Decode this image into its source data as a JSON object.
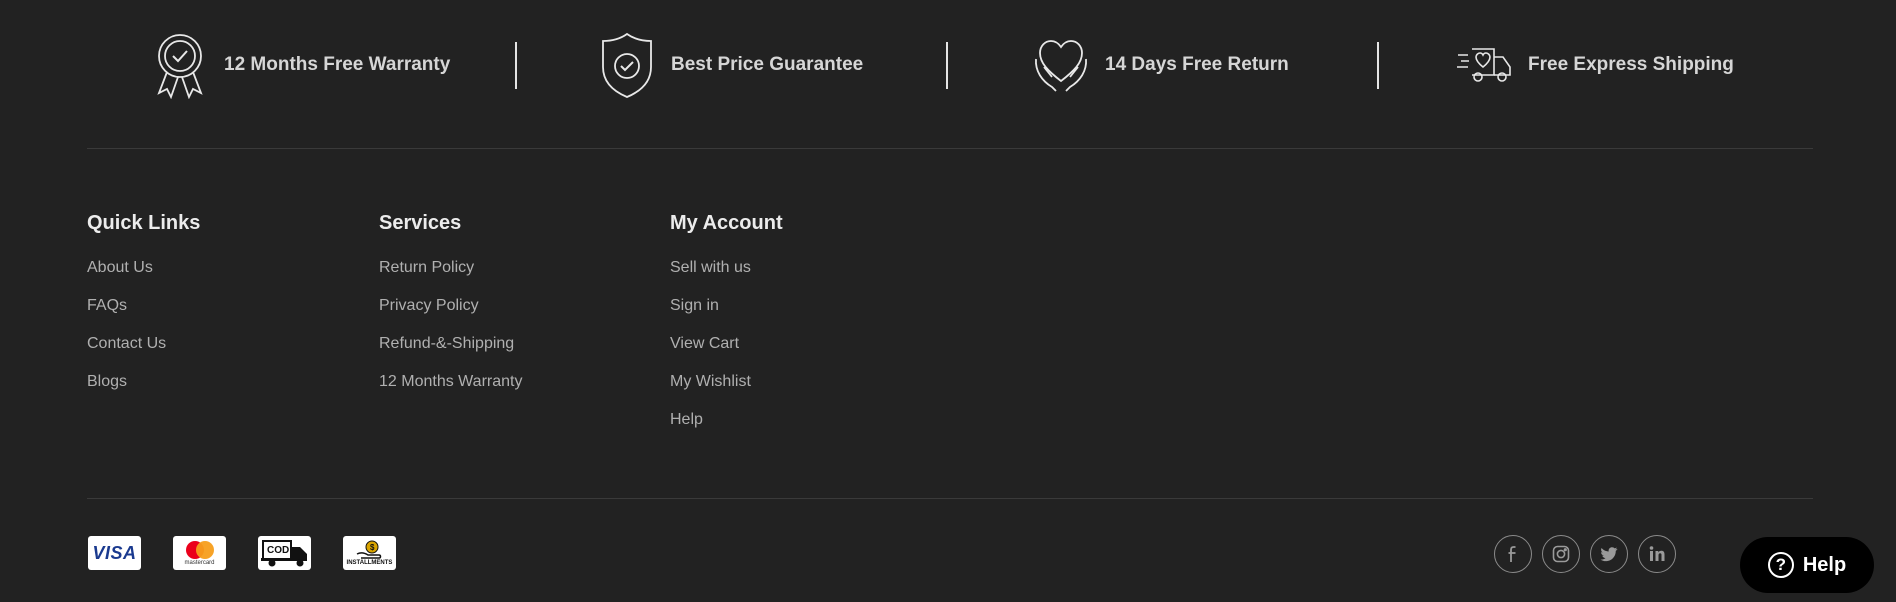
{
  "features": [
    {
      "label": "12 Months Free Warranty",
      "icon": "award-ribbon-icon"
    },
    {
      "label": "Best Price Guarantee",
      "icon": "shield-check-icon"
    },
    {
      "label": "14 Days Free Return",
      "icon": "heart-hands-icon"
    },
    {
      "label": "Free Express Shipping",
      "icon": "delivery-truck-icon"
    }
  ],
  "columns": [
    {
      "title": "Quick Links",
      "items": [
        "About Us",
        "FAQs",
        "Contact Us",
        "Blogs"
      ]
    },
    {
      "title": "Services",
      "items": [
        "Return Policy",
        "Privacy Policy",
        "Refund-&-Shipping",
        "12 Months Warranty"
      ]
    },
    {
      "title": "My Account",
      "items": [
        "Sell with us",
        "Sign in",
        "View Cart",
        "My Wishlist",
        "Help"
      ]
    }
  ],
  "payments": [
    {
      "name": "VISA",
      "icon": "visa-icon"
    },
    {
      "name": "mastercard",
      "icon": "mastercard-icon"
    },
    {
      "name": "COD",
      "icon": "cod-truck-icon"
    },
    {
      "name": "INSTALLMENTS",
      "icon": "installments-icon"
    }
  ],
  "social": [
    "facebook-icon",
    "instagram-icon",
    "twitter-icon",
    "linkedin-icon"
  ],
  "help_button": {
    "label": "Help",
    "glyph": "?"
  },
  "colors": {
    "background": "#222222",
    "text": "#b0b0b0",
    "heading": "#ececec",
    "help_bg": "#000000"
  }
}
